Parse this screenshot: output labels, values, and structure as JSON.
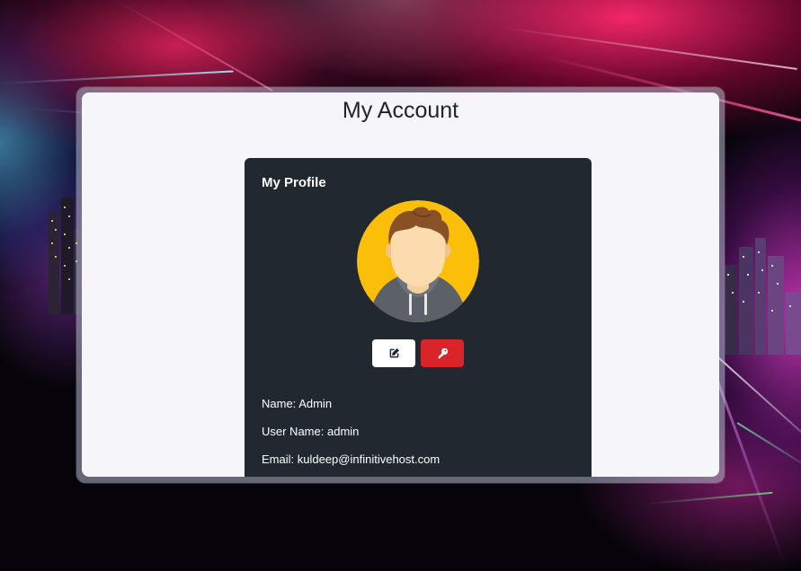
{
  "page": {
    "title": "My Account"
  },
  "profile": {
    "heading": "My Profile",
    "avatar_icon": "user-avatar-icon",
    "name_label": "Name:",
    "name_value": "Admin",
    "username_label": "User Name:",
    "username_value": "admin",
    "email_label": "Email:",
    "email_value": "kuldeep@infinitivehost.com"
  },
  "actions": {
    "edit_icon": "edit-icon",
    "password_icon": "key-icon"
  },
  "colors": {
    "card_background": "#212830",
    "panel_background": "#f5f5fa",
    "edit_button": "#ffffff",
    "password_button": "#d9252a",
    "avatar_background": "#fbbf0a"
  }
}
